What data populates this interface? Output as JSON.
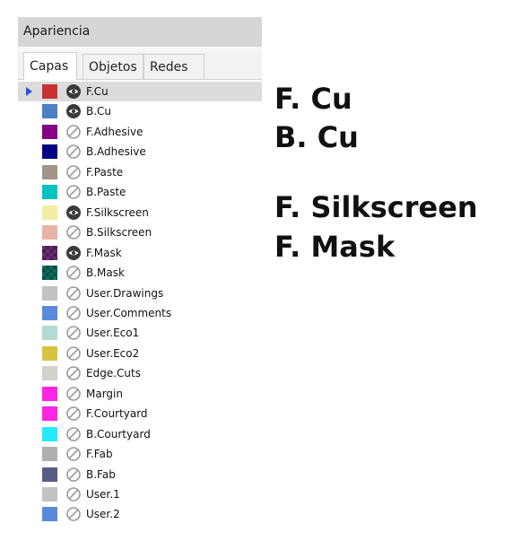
{
  "panel": {
    "title": "Apariencia"
  },
  "tabs": [
    {
      "label": "Capas",
      "active": true
    },
    {
      "label": "Objetos",
      "active": false
    },
    {
      "label": "Redes",
      "active": false
    }
  ],
  "layers": [
    {
      "name": "F.Cu",
      "color": "#c83232",
      "visible": true,
      "selected": true
    },
    {
      "name": "B.Cu",
      "color": "#4d7fc4",
      "visible": true,
      "selected": false
    },
    {
      "name": "F.Adhesive",
      "color": "#840084",
      "visible": false,
      "selected": false
    },
    {
      "name": "B.Adhesive",
      "color": "#000084",
      "visible": false,
      "selected": false
    },
    {
      "name": "F.Paste",
      "color": "#a39488",
      "visible": false,
      "selected": false
    },
    {
      "name": "B.Paste",
      "color": "#00c2c2",
      "visible": false,
      "selected": false
    },
    {
      "name": "F.Silkscreen",
      "color": "#f2eda1",
      "visible": true,
      "selected": false
    },
    {
      "name": "B.Silkscreen",
      "color": "#e8b2a7",
      "visible": false,
      "selected": false
    },
    {
      "name": "F.Mask",
      "color": "#6b2c73",
      "visible": true,
      "selected": false,
      "pattern": true
    },
    {
      "name": "B.Mask",
      "color": "#0c6d5f",
      "visible": false,
      "selected": false,
      "pattern": true
    },
    {
      "name": "User.Drawings",
      "color": "#c2c2c2",
      "visible": false,
      "selected": false
    },
    {
      "name": "User.Comments",
      "color": "#5989db",
      "visible": false,
      "selected": false
    },
    {
      "name": "User.Eco1",
      "color": "#b4dbd2",
      "visible": false,
      "selected": false
    },
    {
      "name": "User.Eco2",
      "color": "#d6c440",
      "visible": false,
      "selected": false
    },
    {
      "name": "Edge.Cuts",
      "color": "#d0d2cd",
      "visible": false,
      "selected": false
    },
    {
      "name": "Margin",
      "color": "#ff26e2",
      "visible": false,
      "selected": false
    },
    {
      "name": "F.Courtyard",
      "color": "#ff26e2",
      "visible": false,
      "selected": false
    },
    {
      "name": "B.Courtyard",
      "color": "#26e9ff",
      "visible": false,
      "selected": false
    },
    {
      "name": "F.Fab",
      "color": "#afafaf",
      "visible": false,
      "selected": false
    },
    {
      "name": "B.Fab",
      "color": "#585d84",
      "visible": false,
      "selected": false
    },
    {
      "name": "User.1",
      "color": "#c2c2c2",
      "visible": false,
      "selected": false
    },
    {
      "name": "User.2",
      "color": "#5989db",
      "visible": false,
      "selected": false
    }
  ],
  "icons": {
    "visible": "eye-icon",
    "hidden": "eye-off-icon",
    "selected": "current-layer-arrow-icon"
  },
  "annotations": [
    "F. Cu",
    "B. Cu",
    "F. Silkscreen",
    "F. Mask"
  ]
}
